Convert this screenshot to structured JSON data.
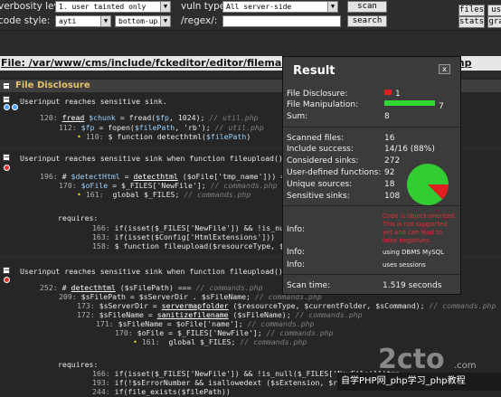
{
  "toolbar": {
    "verbosity_label": "verbosity level:",
    "verbosity_value": "1. user tainted only",
    "vuln_label": "vuln type:",
    "vuln_value": "All server-side",
    "scan_label": "scan",
    "files_label": "files",
    "user_label": "user",
    "code_style_label": "code style:",
    "code_style_value": "ayti",
    "bottom_value": "bottom-up",
    "regex_label": "/regex/:",
    "search_label": "search",
    "stats_label": "stats",
    "graph_label": "graph"
  },
  "file_path": "File: /var/www/cms/include/fckeditor/editor/filemanager/connectors/php/upload.php",
  "block1": {
    "title": "File Disclosure",
    "intro": "Userinput reaches sensitive sink.",
    "l1_no": "120:",
    "l1_fn": "fread",
    "l1_a": " ",
    "l1_var": "$chunk",
    "l1_b": " = fread(",
    "l1_var2": "$fp",
    "l1_c": ", 1024);",
    "l1_cmt": " // util.php",
    "l2_no": "112:",
    "l2_var": "$fp",
    "l2_b": " = fopen(",
    "l2_var2": "$filePath",
    "l2_c": ", 'rb');",
    "l2_cmt": " // util.php",
    "l3_no": "110:",
    "l3_bullet": "•",
    "l3_a": " $ function detecthtml(",
    "l3_var": "$filePath",
    ")": ")",
    "l3_c": ")"
  },
  "block2": {
    "intro": "Userinput reaches sensitive sink when function fileupload() is called.",
    "l1_no": "196:",
    "l1_a": " # ",
    "l1_var": "$detectHtml",
    "l1_b": " = ",
    "l1_fn": "detecthtml",
    "l1_c": " ($oFile['tmp_name'])) ===",
    "l2_no": "170:",
    "l2_a": " ",
    "l2_var": "$oFile",
    "l2_b": " = $_FILES['NewFile'];",
    "l2_cmt": " // commands.php",
    "l3_no": "161:",
    "l3_a": "  global $_FILES;",
    "l3_cmt": " // commands.php",
    "req_label": "requires:",
    "r1_no": "166:",
    "r1_text": " if(isset($_FILES['NewFile']) && !is_null(",
    "r2_no": "163:",
    "r2_text": " if(isset($Config['HtmlExtensions']))",
    "r3_no": "158:",
    "r3_text": " $ function fileupload($resourceType, $currentFo"
  },
  "block3": {
    "intro": "Userinput reaches sensitive sink when function fileupload() is called.",
    "l1_no": "252:",
    "l1_a": " # ",
    "l1_fn": "detecthtml",
    "l1_b": " ($sFilePath) ===",
    "l1_cmt": " // commands.php",
    "l2_no": "209:",
    "l2_text": " $sFilePath = $sServerDir . $sFileName;",
    "l2_cmt": " // commands.php",
    "l3_no": "173:",
    "l3_a": " $sServerDir = ",
    "l3_fn": "servermapfolder",
    "l3_b": " ($resourceType, $currentFolder, $sCommand);",
    "l3_cmt": " // commands.php",
    "l4_no": "172:",
    "l4_a": " $sFileName = ",
    "l4_fn": "sanitizefilename",
    "l4_b": " ($sFileName);",
    "l4_cmt": " // commands.php",
    "l5_no": "171:",
    "l5_text": " $sFileName = $oFile['name'];",
    "l5_cmt": " // commands.php",
    "l6_no": "170:",
    "l6_text": " $oFile = $_FILES['NewFile'];",
    "l6_cmt": " // commands.php",
    "l7_no": "161:",
    "l7_text": "  global $_FILES;",
    "l7_cmt": " // commands.php",
    "req_label": "requires:",
    "r1_no": "166:",
    "r1_text": " if(isset($_FILES['NewFile']) && !is_null($_FILES['NewFile']['tmp",
    "r2_no": "193:",
    "r2_text": " if(!$sErrorNumber && isallowedext ($sExtension, $resource",
    "r3_no": "244:",
    "r3_text": " if(file_exists($filePath))"
  },
  "result": {
    "title": "Result",
    "close": "x",
    "file_disclosure_label": "File Disclosure:",
    "file_disclosure_value": "1",
    "file_manipulation_label": "File Manipulation:",
    "file_manipulation_value": "7",
    "sum_label": "Sum:",
    "sum_value": "8",
    "scanned_label": "Scanned files:",
    "scanned_value": "16",
    "include_label": "Include success:",
    "include_value": "14/16 (88%)",
    "sinks_label": "Considered sinks:",
    "sinks_value": "272",
    "udf_label": "User-defined functions:",
    "udf_value": "92",
    "sources_label": "Unique sources:",
    "sources_value": "18",
    "sensitive_label": "Sensitive sinks:",
    "sensitive_value": "108",
    "info1_label": "Info:",
    "info1_value": "Code is object-oriented. This is not supported yet and can lead to false negatives.",
    "info2_label": "Info:",
    "info2_value": "using DBMS MySQL",
    "info3_label": "Info:",
    "info3_value": "uses sessions",
    "scan_time_label": "Scan time:",
    "scan_time_value": "1.519 seconds"
  },
  "colors": {
    "disclosure": "#e02020",
    "manipulation": "#33d633",
    "pie_green": "#33cc33",
    "pie_red": "#e02020"
  },
  "pie": {
    "file_disclosure_fraction": 0.125,
    "file_manipulation_fraction": 0.875
  },
  "watermark": {
    "brand": "自学PHP网_php学习_php教程"
  }
}
